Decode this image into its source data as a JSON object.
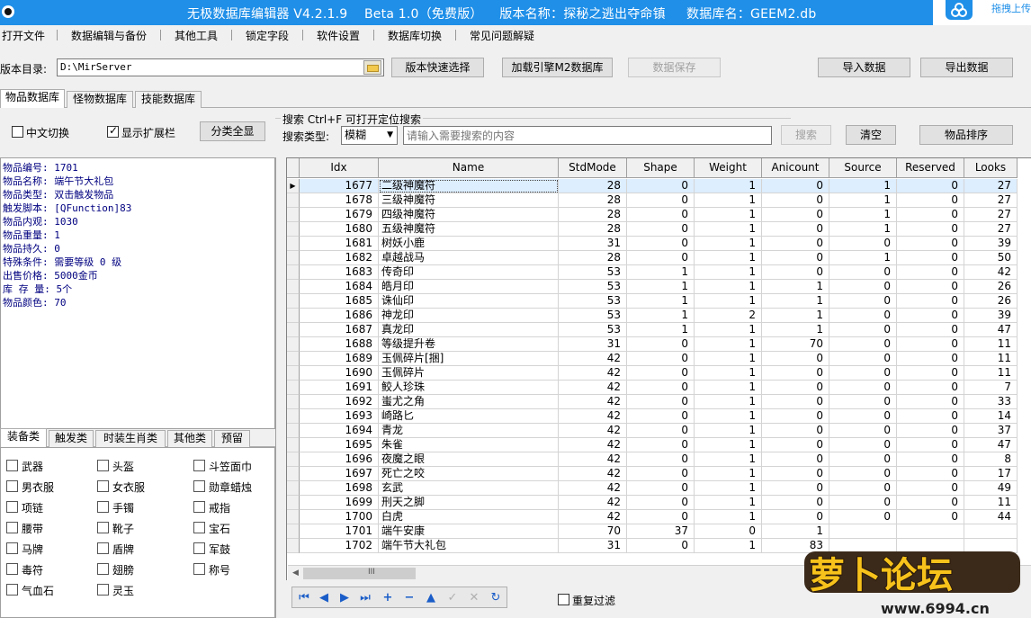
{
  "window": {
    "title": "无极数据库编辑器 V4.2.1.9    Beta 1.0（免费版）    版本名称：探秘之逃出夺命镇     数据库名：GEEM2.db",
    "ext_label": "拖拽上传"
  },
  "menu": [
    "打开文件",
    "数据编辑与备份",
    "其他工具",
    "锁定字段",
    "软件设置",
    "数据库切换",
    "常见问题解疑"
  ],
  "toolbar": {
    "dir_label": "版本目录:",
    "dir_value": "D:\\MirServer",
    "quick_select": "版本快速选择",
    "load_m2": "加载引擎M2数据库",
    "save_data": "数据保存",
    "import_data": "导入数据",
    "export_data": "导出数据"
  },
  "db_tabs": [
    "物品数据库",
    "怪物数据库",
    "技能数据库"
  ],
  "options": {
    "chinese_switch": "中文切换",
    "show_ext": "显示扩展栏",
    "show_all": "分类全显",
    "chinese_checked": false,
    "show_ext_checked": true
  },
  "search": {
    "title": "搜索   Ctrl+F 可打开定位搜索",
    "type_label": "搜索类型:",
    "type_value": "模糊",
    "placeholder": "请输入需要搜索的内容",
    "search_button": "搜索",
    "clear_button": "清空",
    "sort_button": "物品排序"
  },
  "item_info": [
    "物品编号: 1701",
    "物品名称: 端午节大礼包",
    "物品类型: 双击触发物品",
    "触发脚本: [QFunction]83",
    "物品内观: 1030",
    "物品重量: 1",
    "物品持久: 0",
    "特殊条件: 需要等级 0 级",
    "出售价格: 5000金币",
    "库 存 量: 5个",
    "物品颜色: 70"
  ],
  "category_tabs": [
    "装备类",
    "触发类",
    "时装生肖类",
    "其他类",
    "预留"
  ],
  "categories": [
    [
      "武器",
      "头盔",
      "斗笠面巾"
    ],
    [
      "男衣服",
      "女衣服",
      "勋章蜡烛"
    ],
    [
      "项链",
      "手镯",
      "戒指"
    ],
    [
      "腰带",
      "靴子",
      "宝石"
    ],
    [
      "马牌",
      "盾牌",
      "军鼓"
    ],
    [
      "毒符",
      "翅膀",
      "称号"
    ],
    [
      "气血石",
      "灵玉",
      ""
    ]
  ],
  "grid": {
    "columns": [
      "Idx",
      "Name",
      "StdMode",
      "Shape",
      "Weight",
      "Anicount",
      "Source",
      "Reserved",
      "Looks"
    ],
    "rows": [
      [
        "1677",
        "二级神魔符",
        "28",
        "0",
        "1",
        "0",
        "1",
        "0",
        "27"
      ],
      [
        "1678",
        "三级神魔符",
        "28",
        "0",
        "1",
        "0",
        "1",
        "0",
        "27"
      ],
      [
        "1679",
        "四级神魔符",
        "28",
        "0",
        "1",
        "0",
        "1",
        "0",
        "27"
      ],
      [
        "1680",
        "五级神魔符",
        "28",
        "0",
        "1",
        "0",
        "1",
        "0",
        "27"
      ],
      [
        "1681",
        "树妖小鹿",
        "31",
        "0",
        "1",
        "0",
        "0",
        "0",
        "39"
      ],
      [
        "1682",
        "卓越战马",
        "28",
        "0",
        "1",
        "0",
        "1",
        "0",
        "50"
      ],
      [
        "1683",
        "传奇印",
        "53",
        "1",
        "1",
        "0",
        "0",
        "0",
        "42"
      ],
      [
        "1684",
        "皓月印",
        "53",
        "1",
        "1",
        "1",
        "0",
        "0",
        "26"
      ],
      [
        "1685",
        "诛仙印",
        "53",
        "1",
        "1",
        "1",
        "0",
        "0",
        "26"
      ],
      [
        "1686",
        "神龙印",
        "53",
        "1",
        "2",
        "1",
        "0",
        "0",
        "39"
      ],
      [
        "1687",
        "真龙印",
        "53",
        "1",
        "1",
        "1",
        "0",
        "0",
        "47"
      ],
      [
        "1688",
        "等级提升卷",
        "31",
        "0",
        "1",
        "70",
        "0",
        "0",
        "11"
      ],
      [
        "1689",
        "玉佩碎片[捆]",
        "42",
        "0",
        "1",
        "0",
        "0",
        "0",
        "11"
      ],
      [
        "1690",
        "玉佩碎片",
        "42",
        "0",
        "1",
        "0",
        "0",
        "0",
        "11"
      ],
      [
        "1691",
        "鲛人珍珠",
        "42",
        "0",
        "1",
        "0",
        "0",
        "0",
        "7"
      ],
      [
        "1692",
        "蚩尤之角",
        "42",
        "0",
        "1",
        "0",
        "0",
        "0",
        "33"
      ],
      [
        "1693",
        "崎路匕",
        "42",
        "0",
        "1",
        "0",
        "0",
        "0",
        "14"
      ],
      [
        "1694",
        "青龙",
        "42",
        "0",
        "1",
        "0",
        "0",
        "0",
        "37"
      ],
      [
        "1695",
        "朱雀",
        "42",
        "0",
        "1",
        "0",
        "0",
        "0",
        "47"
      ],
      [
        "1696",
        "夜魔之眼",
        "42",
        "0",
        "1",
        "0",
        "0",
        "0",
        "8"
      ],
      [
        "1697",
        "死亡之咬",
        "42",
        "0",
        "1",
        "0",
        "0",
        "0",
        "17"
      ],
      [
        "1698",
        "玄武",
        "42",
        "0",
        "1",
        "0",
        "0",
        "0",
        "49"
      ],
      [
        "1699",
        "刑天之脚",
        "42",
        "0",
        "1",
        "0",
        "0",
        "0",
        "11"
      ],
      [
        "1700",
        "白虎",
        "42",
        "0",
        "1",
        "0",
        "0",
        "0",
        "44"
      ],
      [
        "1701",
        "端午安康",
        "70",
        "37",
        "0",
        "1",
        "",
        "",
        ""
      ],
      [
        "1702",
        "端午节大礼包",
        "31",
        "0",
        "1",
        "83",
        "",
        "",
        ""
      ]
    ]
  },
  "footer": {
    "repeat_filter": "重复过滤",
    "scroll_grip": "III"
  },
  "watermark": {
    "brand": "萝卜论坛",
    "url": "www.6994.cn"
  },
  "colors": {
    "titlebar": "#1f8fe8",
    "info_text": "#000080",
    "nav_icon": "#1a5dc8"
  }
}
